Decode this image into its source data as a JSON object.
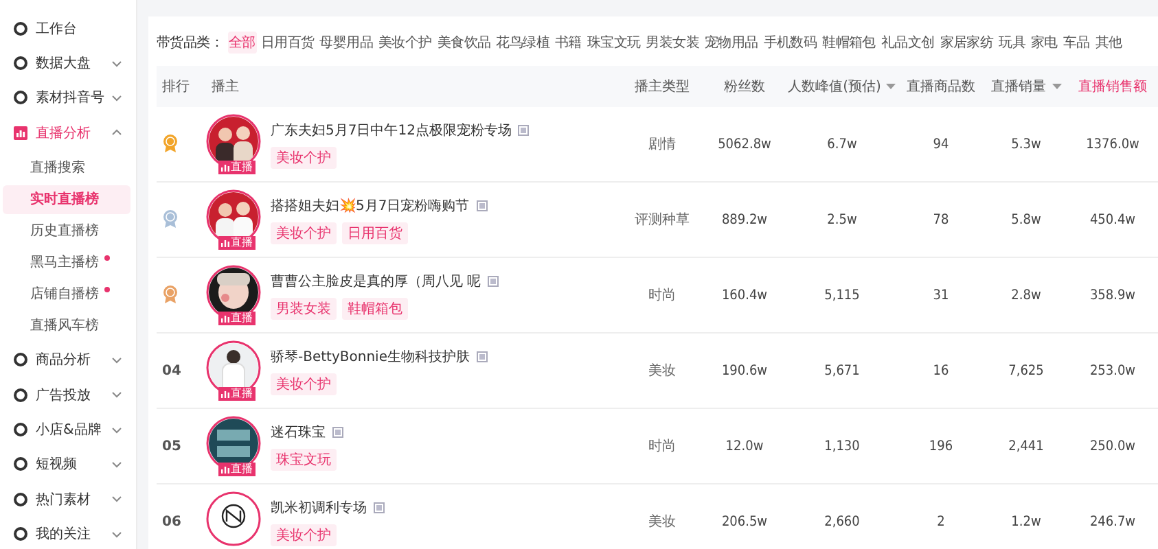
{
  "sidebar": {
    "items": [
      {
        "label": "工作台",
        "selected": false
      },
      {
        "label": "数据大盘",
        "selected": false,
        "expanded": false
      },
      {
        "label": "素材抖音号",
        "selected": false,
        "expanded": false
      },
      {
        "label": "直播分析",
        "selected": true,
        "expanded": true,
        "children": [
          {
            "label": "直播搜索",
            "selected": false,
            "dot": false
          },
          {
            "label": "实时直播榜",
            "selected": true,
            "dot": false
          },
          {
            "label": "历史直播榜",
            "selected": false,
            "dot": false
          },
          {
            "label": "黑马主播榜",
            "selected": false,
            "dot": true
          },
          {
            "label": "店铺自播榜",
            "selected": false,
            "dot": true
          },
          {
            "label": "直播风车榜",
            "selected": false,
            "dot": false
          }
        ]
      },
      {
        "label": "商品分析",
        "selected": false,
        "expanded": false
      },
      {
        "label": "广告投放",
        "selected": false,
        "expanded": false
      },
      {
        "label": "小店&品牌",
        "selected": false,
        "expanded": false
      },
      {
        "label": "短视频",
        "selected": false,
        "expanded": false
      },
      {
        "label": "热门素材",
        "selected": false,
        "expanded": false
      },
      {
        "label": "我的关注",
        "selected": false,
        "expanded": false
      }
    ]
  },
  "filter": {
    "label": "带货品类：",
    "options": [
      {
        "label": "全部",
        "selected": true
      },
      {
        "label": "日用百货",
        "selected": false
      },
      {
        "label": "母婴用品",
        "selected": false
      },
      {
        "label": "美妆个护",
        "selected": false
      },
      {
        "label": "美食饮品",
        "selected": false
      },
      {
        "label": "花鸟绿植",
        "selected": false
      },
      {
        "label": "书籍",
        "selected": false
      },
      {
        "label": "珠宝文玩",
        "selected": false
      },
      {
        "label": "男装女装",
        "selected": false
      },
      {
        "label": "宠物用品",
        "selected": false
      },
      {
        "label": "手机数码",
        "selected": false
      },
      {
        "label": "鞋帽箱包",
        "selected": false
      },
      {
        "label": "礼品文创",
        "selected": false
      },
      {
        "label": "家居家纺",
        "selected": false
      },
      {
        "label": "玩具",
        "selected": false
      },
      {
        "label": "家电",
        "selected": false
      },
      {
        "label": "车品",
        "selected": false
      },
      {
        "label": "其他",
        "selected": false
      }
    ]
  },
  "table": {
    "columns": [
      {
        "label": "排行",
        "sortable": false,
        "highlighted": false
      },
      {
        "label": "播主",
        "sortable": false,
        "highlighted": false
      },
      {
        "label": "播主类型",
        "sortable": false,
        "highlighted": false
      },
      {
        "label": "粉丝数",
        "sortable": false,
        "highlighted": false
      },
      {
        "label": "人数峰值(预估)",
        "sortable": true,
        "highlighted": false
      },
      {
        "label": "直播商品数",
        "sortable": false,
        "highlighted": false
      },
      {
        "label": "直播销量",
        "sortable": true,
        "highlighted": false
      },
      {
        "label": "直播销售额",
        "sortable": false,
        "highlighted": true
      }
    ],
    "rows": [
      {
        "kind": "medal",
        "color": "#f2a52a",
        "name": "广东夫妇5月7日中午12点极限宠粉专场",
        "badge": "直播",
        "tags": [
          "美妆个护"
        ],
        "type": "剧情",
        "fans": "5062.8w",
        "peak": "6.7w",
        "items": "94",
        "sales": "5.3w",
        "revenue": "1376.0w"
      },
      {
        "kind": "medal",
        "color": "#a9bfd8",
        "name": "搭搭姐夫妇💥5月7日宠粉嗨购节",
        "badge": "直播",
        "tags": [
          "美妆个护",
          "日用百货"
        ],
        "type": "评测种草",
        "fans": "889.2w",
        "peak": "2.5w",
        "items": "78",
        "sales": "5.8w",
        "revenue": "450.4w"
      },
      {
        "kind": "medal",
        "color": "#e9a266",
        "name": "曹曹公主脸皮是真的厚（周八见 呢",
        "badge": "直播",
        "tags": [
          "男装女装",
          "鞋帽箱包"
        ],
        "type": "时尚",
        "fans": "160.4w",
        "peak": "5,115",
        "items": "31",
        "sales": "2.8w",
        "revenue": "358.9w"
      },
      {
        "kind": "number",
        "rank": "04",
        "name": "骄琴-BettyBonnie生物科技护肤",
        "badge": "直播",
        "tags": [
          "美妆个护"
        ],
        "type": "美妆",
        "fans": "190.6w",
        "peak": "5,671",
        "items": "16",
        "sales": "7,625",
        "revenue": "253.0w"
      },
      {
        "kind": "number",
        "rank": "05",
        "name": "迷石珠宝",
        "badge": "直播",
        "tags": [
          "珠宝文玩"
        ],
        "type": "时尚",
        "fans": "12.0w",
        "peak": "1,130",
        "items": "196",
        "sales": "2,441",
        "revenue": "250.0w"
      },
      {
        "kind": "number",
        "rank": "06",
        "name": "凯米初调利专场",
        "tags": [
          "美妆个护"
        ],
        "type": "美妆",
        "fans": "206.5w",
        "peak": "2,660",
        "items": "2",
        "sales": "1.2w",
        "revenue": "246.7w"
      }
    ]
  }
}
